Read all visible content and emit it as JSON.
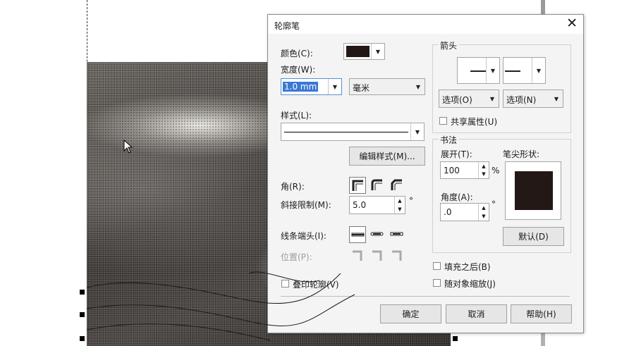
{
  "dialog": {
    "title": "轮廓笔",
    "close_label": "✕",
    "color_label": "颜色(C):",
    "color_value": "#231815",
    "width_label": "宽度(W):",
    "width_value": "1.0 mm",
    "unit_value": "毫米",
    "style_label": "样式(L):",
    "edit_style_button": "编辑样式(M)...",
    "corner_label": "角(R):",
    "miter_label": "斜接限制(M):",
    "miter_value": "5.0",
    "miter_unit": "°",
    "linecap_label": "线条端头(I):",
    "position_label": "位置(P):",
    "overprint_label": "叠印轮廓(V)",
    "arrows": {
      "group_label": "箭头",
      "options_left": "选项(O)",
      "options_right": "选项(N)",
      "share_label": "共享属性(U)"
    },
    "calligraphy": {
      "group_label": "书法",
      "stretch_label": "展开(T):",
      "stretch_value": "100",
      "stretch_unit": "%",
      "angle_label": "角度(A):",
      "angle_value": ".0",
      "angle_unit": "°",
      "nib_label": "笔尖形状:",
      "default_button": "默认(D)"
    },
    "behind_fill_label": "填充之后(B)",
    "scale_label": "随对象缩放(J)",
    "ok_button": "确定",
    "cancel_button": "取消",
    "help_button": "帮助(H)"
  }
}
